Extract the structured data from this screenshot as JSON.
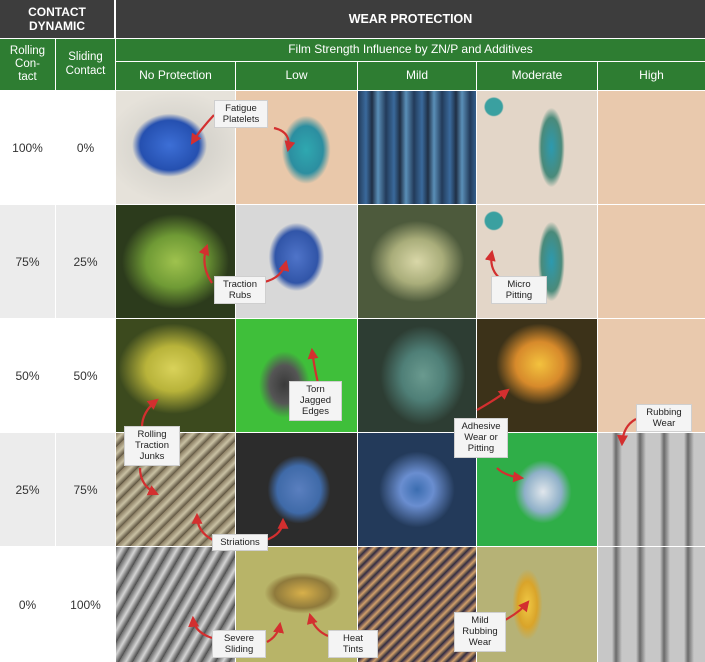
{
  "header": {
    "contact_dynamic": "CONTACT DYNAMIC",
    "wear_protection": "WEAR PROTECTION",
    "rolling_contact": "Rolling\nCon-\ntact",
    "sliding_contact": "Sliding\nContact",
    "film_strength": "Film Strength Influence by ZN/P and Additives",
    "columns": [
      "No Protection",
      "Low",
      "Mild",
      "Moderate",
      "High"
    ]
  },
  "rows": [
    {
      "rolling": "100%",
      "sliding": "0%"
    },
    {
      "rolling": "75%",
      "sliding": "25%"
    },
    {
      "rolling": "50%",
      "sliding": "50%"
    },
    {
      "rolling": "25%",
      "sliding": "75%"
    },
    {
      "rolling": "0%",
      "sliding": "100%"
    }
  ],
  "annotations": {
    "fatigue_platelets": "Fatigue\nPlatelets",
    "traction_rubs": "Traction\nRubs",
    "micro_pitting": "Micro\nPitting",
    "torn_jagged_edges": "Torn\nJagged\nEdges",
    "rolling_traction_junks": "Rolling\nTraction\nJunks",
    "adhesive_wear": "Adhesive\nWear or\nPitting",
    "rubbing_wear": "Rubbing\nWear",
    "striations": "Striations",
    "severe_sliding": "Severe\nSliding",
    "heat_tints": "Heat\nTints",
    "mild_rubbing_wear": "Mild\nRubbing\nWear"
  },
  "colors": {
    "header_dark": "#3d3d3d",
    "header_green": "#2e7d32",
    "row_shade": "#ececec",
    "arrow": "#d32f2f",
    "empty_cell": "#e9c9ad"
  }
}
